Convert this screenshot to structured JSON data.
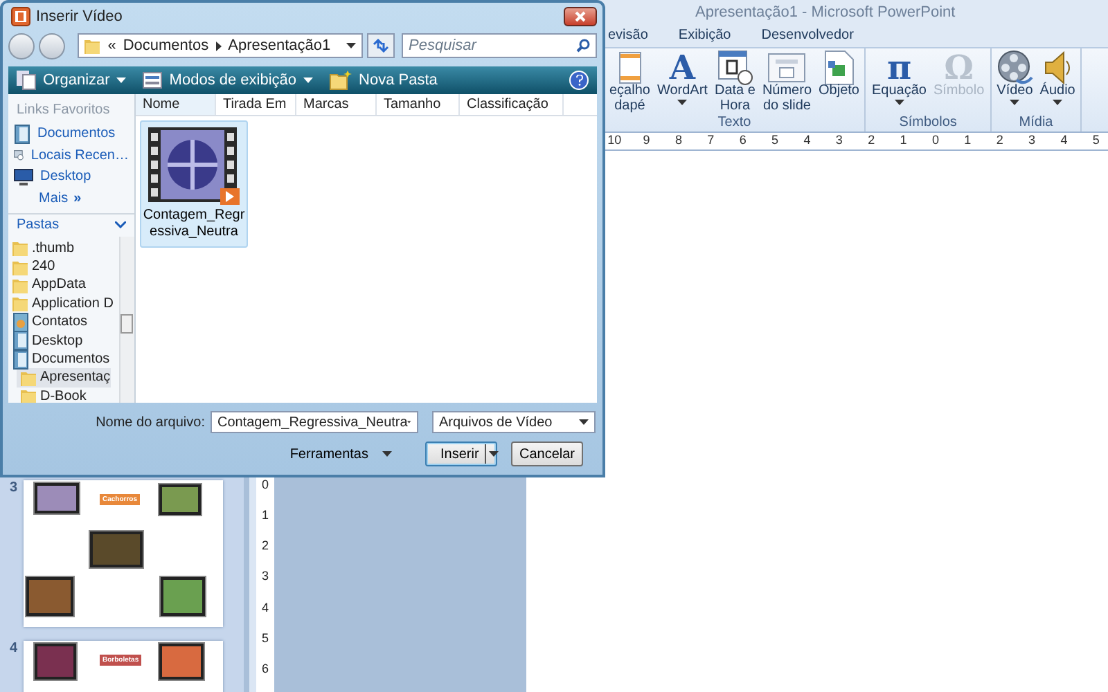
{
  "app": {
    "title": "Apresentação1 - Microsoft PowerPoint",
    "tabs": [
      {
        "label": "evisão",
        "selected": false
      },
      {
        "label": "Exibição",
        "selected": false
      },
      {
        "label": "Desenvolvedor",
        "selected": false
      }
    ],
    "ribbon_groups": [
      {
        "label": "Texto",
        "buttons": [
          {
            "lines": [
              "eçalho",
              "dapé"
            ],
            "kind": "page",
            "dropdown": false,
            "disabled": false
          },
          {
            "lines": [
              "WordArt"
            ],
            "kind": "glyph",
            "glyph": "A",
            "dropdown": true,
            "disabled": false
          },
          {
            "lines": [
              "Data e",
              "Hora"
            ],
            "kind": "calendar",
            "dropdown": false,
            "disabled": false
          },
          {
            "lines": [
              "Número",
              "do slide"
            ],
            "kind": "number",
            "dropdown": false,
            "disabled": false
          },
          {
            "lines": [
              "Objeto"
            ],
            "kind": "object",
            "dropdown": false,
            "disabled": false
          }
        ]
      },
      {
        "label": "Símbolos",
        "buttons": [
          {
            "lines": [
              "Equação"
            ],
            "kind": "glyph",
            "glyph": "π",
            "dropdown": true,
            "disabled": false
          },
          {
            "lines": [
              "Símbolo"
            ],
            "kind": "glyph",
            "glyph": "Ω",
            "dropdown": false,
            "disabled": true
          }
        ]
      },
      {
        "label": "Mídia",
        "buttons": [
          {
            "lines": [
              "Vídeo"
            ],
            "kind": "film",
            "dropdown": true,
            "disabled": false
          },
          {
            "lines": [
              "Áudio"
            ],
            "kind": "speaker",
            "dropdown": true,
            "disabled": false
          }
        ]
      }
    ],
    "hruler": [
      "10",
      "9",
      "8",
      "7",
      "6",
      "5",
      "4",
      "3",
      "2",
      "1",
      "0",
      "1",
      "2",
      "3",
      "4",
      "5"
    ],
    "vruler": [
      "0",
      "1",
      "2",
      "3",
      "4",
      "5",
      "6"
    ],
    "slides": [
      {
        "number": "3",
        "title": "Cachorros",
        "color": "#e8883a",
        "kind": "mosaic"
      },
      {
        "number": "4",
        "title": "Borboletas",
        "color": "#c0504d",
        "kind": "pair"
      }
    ]
  },
  "dialog": {
    "title": "Inserir Vídeo",
    "path": [
      "«",
      "Documentos",
      "Apresentação1"
    ],
    "search_placeholder": "Pesquisar",
    "toolbar": [
      {
        "label": "Organizar",
        "kind": "organize",
        "dropdown": true
      },
      {
        "label": "Modos de exibição",
        "kind": "views",
        "dropdown": true
      },
      {
        "label": "Nova Pasta",
        "kind": "new-folder",
        "dropdown": false
      }
    ],
    "favorites_header": "Links Favoritos",
    "favorites": [
      {
        "label": "Documentos",
        "kind": "documents"
      },
      {
        "label": "Locais Recen…",
        "kind": "recent"
      },
      {
        "label": "Desktop",
        "kind": "desktop"
      }
    ],
    "more": {
      "label": "Mais",
      "glyph": "»"
    },
    "folders_header": "Pastas",
    "folders": [
      {
        "label": ".thumb",
        "kind": "folder",
        "selected": false
      },
      {
        "label": "240",
        "kind": "folder",
        "selected": false
      },
      {
        "label": "AppData",
        "kind": "folder",
        "selected": false
      },
      {
        "label": "Application D",
        "kind": "folder",
        "selected": false
      },
      {
        "label": "Contatos",
        "kind": "contacts",
        "selected": false
      },
      {
        "label": "Desktop",
        "kind": "documents",
        "selected": false
      },
      {
        "label": "Documentos",
        "kind": "documents",
        "selected": false,
        "children": [
          {
            "label": "Apresentaç",
            "kind": "folder",
            "selected": true
          },
          {
            "label": "D-Book",
            "kind": "folder",
            "selected": false
          }
        ]
      }
    ],
    "columns": [
      {
        "label": "Nome",
        "sorted": true
      },
      {
        "label": "Tirada Em",
        "sorted": false
      },
      {
        "label": "Marcas",
        "sorted": false
      },
      {
        "label": "Tamanho",
        "sorted": false
      },
      {
        "label": "Classificação",
        "sorted": false
      }
    ],
    "files": [
      {
        "name": "Contagem_Regressiva_Neutra",
        "selected": true
      }
    ],
    "filename_label": "Nome do arquivo:",
    "filename": "Contagem_Regressiva_Neutra",
    "filetype": "Arquivos de Vídeo",
    "tools": "Ferramentas",
    "buttons": [
      {
        "label": "Inserir",
        "kind": "split"
      },
      {
        "label": "Cancelar",
        "kind": "plain"
      }
    ]
  }
}
